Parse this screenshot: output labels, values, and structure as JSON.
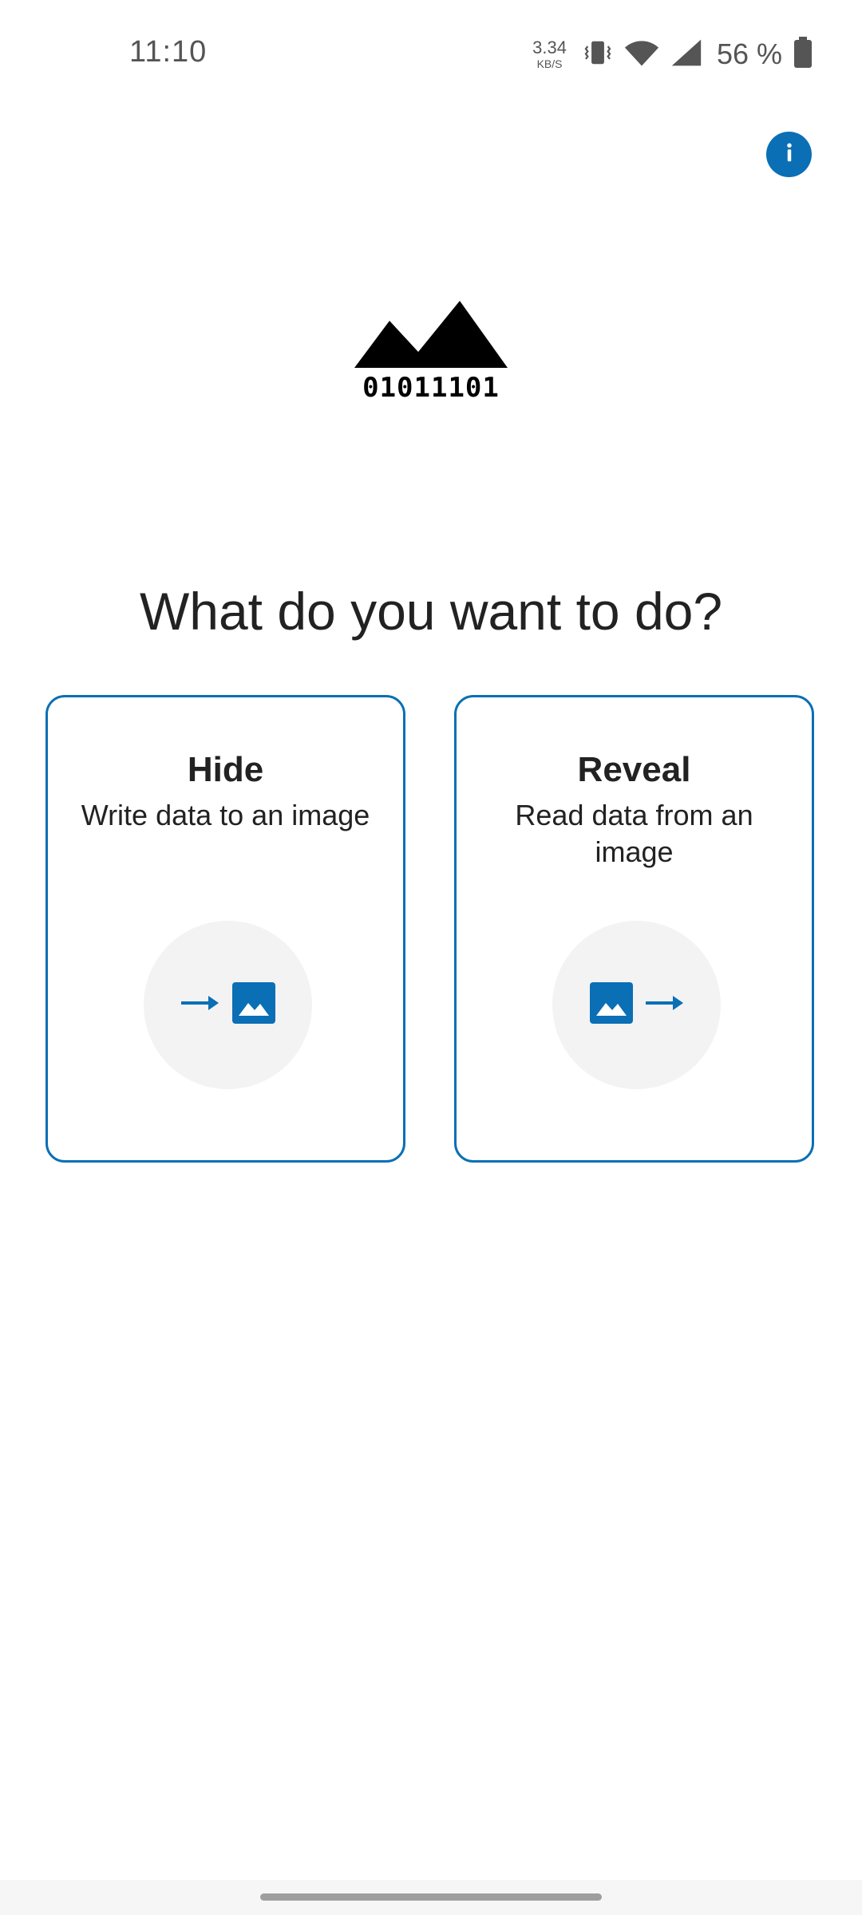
{
  "status_bar": {
    "time": "11:10",
    "net_speed_value": "3.34",
    "net_speed_unit": "KB/S",
    "battery_percent": "56 %",
    "icons": [
      "vibrate-icon",
      "wifi-icon",
      "signal-icon",
      "battery-icon"
    ]
  },
  "header": {
    "info_icon": "info-icon"
  },
  "logo": {
    "text": "01011101"
  },
  "main": {
    "title": "What do you want to do?",
    "options": [
      {
        "title": "Hide",
        "description": "Write data to an image",
        "icons": [
          "arrow-right-icon",
          "image-icon"
        ]
      },
      {
        "title": "Reveal",
        "description": "Read data from an image",
        "icons": [
          "image-icon",
          "arrow-right-icon"
        ]
      }
    ]
  },
  "colors": {
    "accent": "#0a6fb5",
    "icon_circle": "#f3f3f3",
    "text": "#222222"
  }
}
